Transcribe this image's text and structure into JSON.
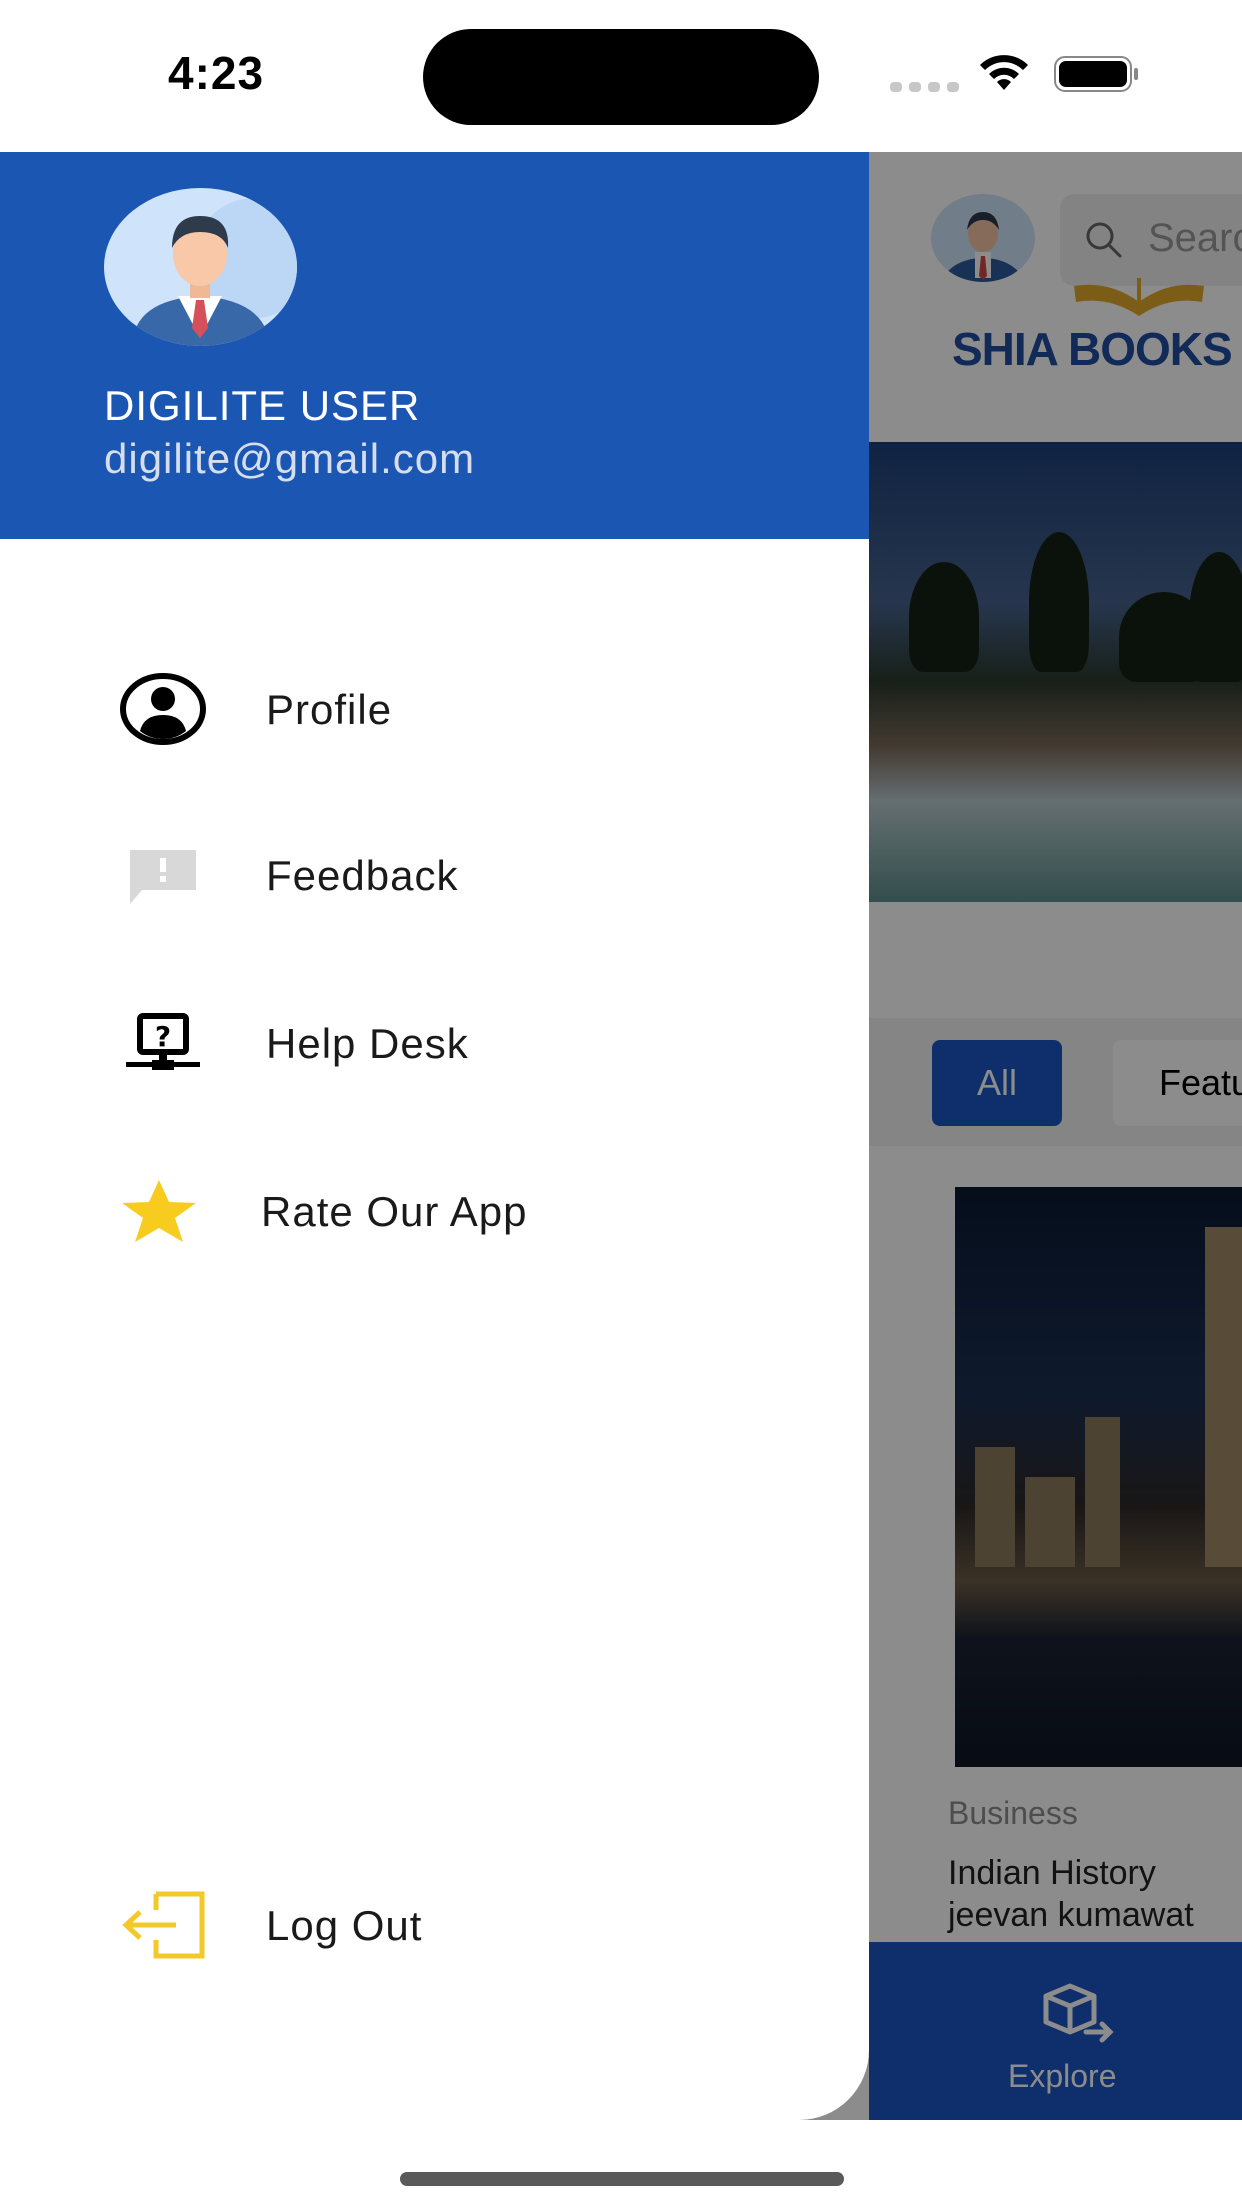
{
  "status_bar": {
    "time": "4:23"
  },
  "drawer": {
    "user_name": "DIGILITE USER",
    "user_email": "digilite@gmail.com",
    "menu": [
      {
        "label": "Profile",
        "icon": "profile-icon"
      },
      {
        "label": "Feedback",
        "icon": "feedback-icon"
      },
      {
        "label": "Help Desk",
        "icon": "help-desk-icon"
      },
      {
        "label": "Rate Our App",
        "icon": "star-icon"
      }
    ],
    "logout_label": "Log Out"
  },
  "background_app": {
    "search_placeholder": "Search",
    "logo_text": "SHIA BOOKS",
    "tabs": [
      "All",
      "Featured"
    ],
    "card": {
      "category": "Business",
      "title": "Indian History",
      "author": "jeevan kumawat"
    },
    "bottom_nav": {
      "explore_label": "Explore"
    }
  },
  "colors": {
    "header_blue": "#1a56b2",
    "nav_blue": "#1b56c3",
    "star_yellow": "#f7cc1e",
    "logout_yellow": "#f3c829"
  }
}
